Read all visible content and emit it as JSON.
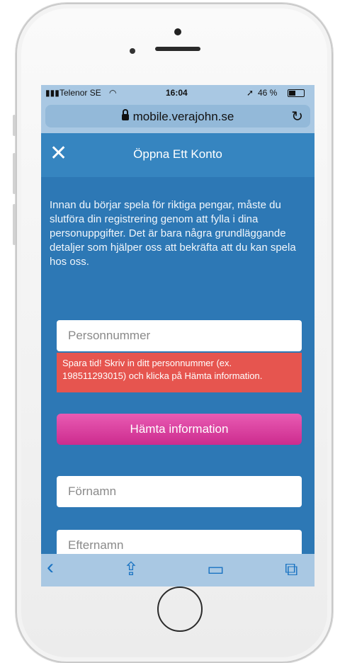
{
  "statusbar": {
    "carrier": "Telenor SE",
    "time": "16:04",
    "battery": "46 %"
  },
  "browser": {
    "url": "mobile.verajohn.se",
    "icons": [
      "lock-icon",
      "reload-icon",
      "back-icon",
      "share-icon",
      "bookmarks-icon",
      "tabs-icon"
    ]
  },
  "header": {
    "close_label": "✕",
    "title": "Öppna Ett Konto"
  },
  "intro_text": "Innan du börjar spela för riktiga pengar, måste du slutföra din registrering genom att fylla i dina personuppgifter. Det är bara några grundläggande detaljer som hjälper oss att bekräfta att du kan spela hos oss.",
  "form": {
    "personnummer_placeholder": "Personnummer",
    "error_text": "Spara tid! Skriv in ditt personnummer (ex. 198511293015) och klicka på Hämta information.",
    "fetch_button_label": "Hämta information",
    "fornamn_placeholder": "Förnamn",
    "efternamn_placeholder": "Efternamn"
  },
  "colors": {
    "accent": "#3685c0",
    "button": "#d9359b",
    "error": "#e6554f"
  }
}
